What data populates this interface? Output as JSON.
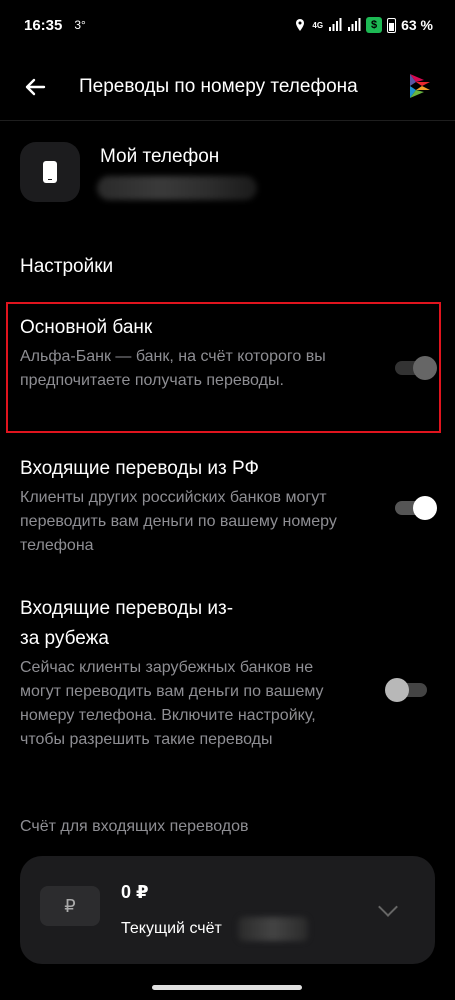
{
  "status_bar": {
    "time": "16:35",
    "temperature": "3°",
    "network": "4G",
    "battery_percent": "63 %"
  },
  "header": {
    "title": "Переводы по номеру телефона",
    "back_icon": "arrow-left-icon",
    "logo_icon": "sbp-logo-icon"
  },
  "phone": {
    "label": "Мой телефон",
    "icon": "smartphone-icon"
  },
  "settings_section": {
    "title": "Настройки",
    "items": [
      {
        "title": "Основной банк",
        "description": "Альфа-Банк — банк, на счёт которого вы предпочитаете получать переводы.",
        "toggle_state": "on-disabled"
      },
      {
        "title": "Входящие переводы из РФ",
        "description": "Клиенты других российских банков могут переводить вам деньги по вашему номеру телефона",
        "toggle_state": "on"
      },
      {
        "title": "Входящие переводы из-за рубежа",
        "description": "Сейчас клиенты зарубежных банков не могут переводить вам деньги по вашему номеру телефона. Включите настройку, чтобы разрешить такие переводы",
        "toggle_state": "off"
      }
    ]
  },
  "account": {
    "section_label": "Счёт для входящих переводов",
    "currency_symbol": "₽",
    "balance": "0 ₽",
    "name": "Текущий счёт"
  },
  "colors": {
    "background": "#000000",
    "card": "#1c1c1e",
    "secondary_text": "#8e8e93",
    "highlight": "#e0141e"
  }
}
